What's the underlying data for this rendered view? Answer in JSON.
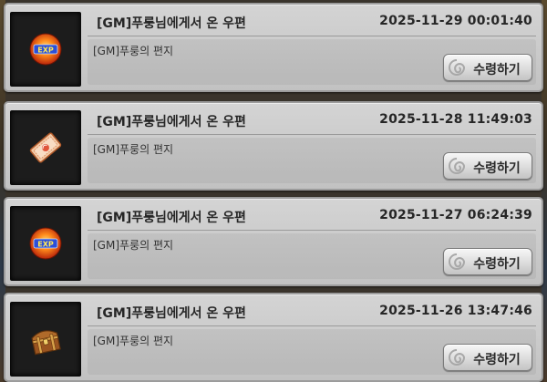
{
  "mail_items": [
    {
      "title": "[GM]푸룽님에게서 온 우편",
      "timestamp": "2025-11-29 00:01:40",
      "body": "[GM]푸룽의 편지",
      "claim_label": "수령하기",
      "icon": "exp-orb-icon"
    },
    {
      "title": "[GM]푸룽님에게서 온 우편",
      "timestamp": "2025-11-28 11:49:03",
      "body": "[GM]푸룽의 편지",
      "claim_label": "수령하기",
      "icon": "ticket-coupon-icon"
    },
    {
      "title": "[GM]푸룽님에게서 온 우편",
      "timestamp": "2025-11-27 06:24:39",
      "body": "[GM]푸룽의 편지",
      "claim_label": "수령하기",
      "icon": "exp-orb-icon"
    },
    {
      "title": "[GM]푸룽님에게서 온 우편",
      "timestamp": "2025-11-26 13:47:46",
      "body": "[GM]푸룽의 편지",
      "claim_label": "수령하기",
      "icon": "treasure-chest-icon"
    }
  ],
  "exp_orb_label": "EXP"
}
